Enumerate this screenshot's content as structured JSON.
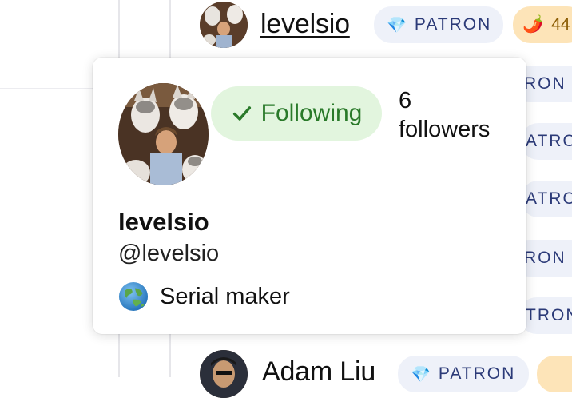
{
  "top_row": {
    "name": "levelsio",
    "badge": {
      "icon": "gem-icon",
      "label": "PATRON"
    },
    "streak": {
      "icon": "chili-pepper-icon",
      "count": "44"
    }
  },
  "side_badges": [
    "RON",
    "ATRO",
    "ATRO",
    "RON",
    "TRON"
  ],
  "bottom_row": {
    "name": "Adam Liu",
    "badge": {
      "icon": "gem-icon",
      "label": "PATRON"
    }
  },
  "popover": {
    "follow_label": "Following",
    "followers_count": "6",
    "followers_label": "followers",
    "name": "levelsio",
    "handle": "@levelsio",
    "bio": "Serial maker",
    "bio_icon": "globe-icon"
  },
  "colors": {
    "following_bg": "#e2f5de",
    "following_text": "#2a7a2a",
    "patron_bg": "#eef1f9",
    "patron_text": "#2b3a78"
  }
}
